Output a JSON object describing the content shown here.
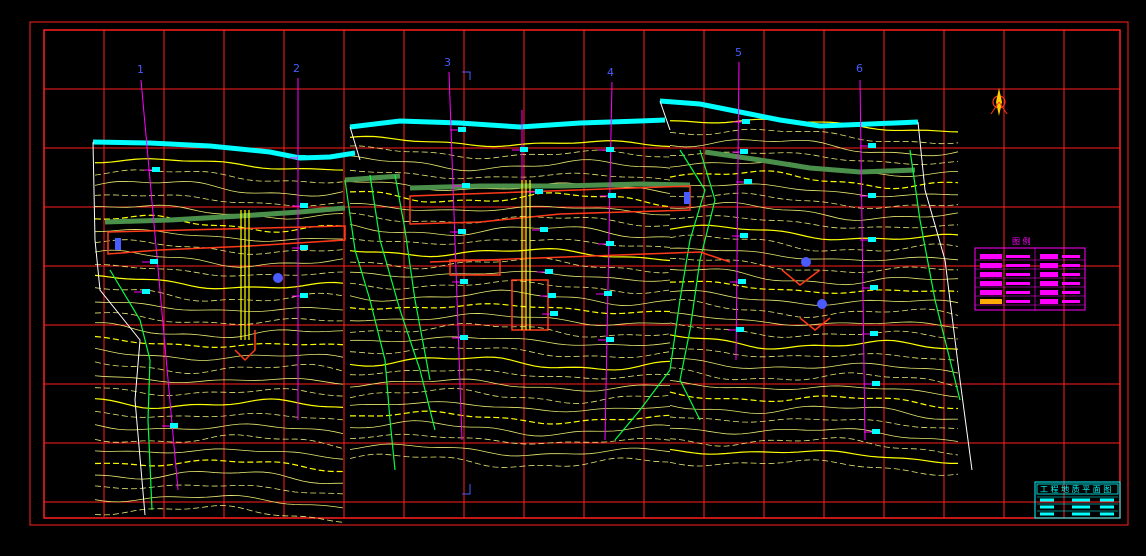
{
  "drawing": {
    "background": "#000000",
    "colors": {
      "frame": "#ff2020",
      "contour_major": "#ffff00",
      "contour_minor": "#ffffaa",
      "river_bank": "#00ffff",
      "section_line": "#ff00ff",
      "section_label": "#4a5bff",
      "fault_line": "#00ff44",
      "road": "#4a8f4a",
      "structure": "#ff3a1a",
      "legend": "#ff00ff",
      "titleblock": "#00ffff"
    },
    "section_labels": [
      "1",
      "2",
      "3",
      "4",
      "5",
      "6"
    ],
    "icons": [
      "north-arrow-icon",
      "survey-marker-icon"
    ],
    "legend": {
      "title": "图 例"
    },
    "title_block": {
      "title": "工 程 地 质 平 面 图"
    }
  }
}
